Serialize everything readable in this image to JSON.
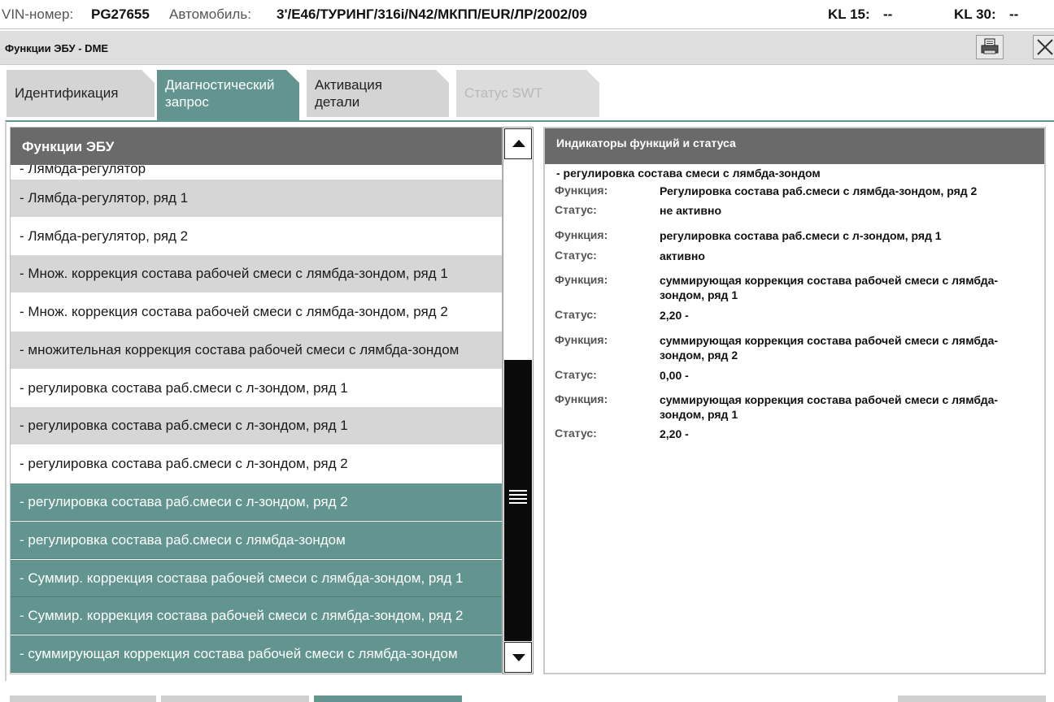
{
  "infobar": {
    "vin_label": "VIN-номер:",
    "vin_value": "PG27655",
    "car_label": "Автомобиль:",
    "car_value": "3'/E46/ТУРИНГ/316i/N42/МКПП/EUR/ЛР/2002/09",
    "kl15_label": "KL 15:",
    "kl15_value": "--",
    "kl30_label": "KL 30:",
    "kl30_value": "--"
  },
  "window": {
    "title": "Функции ЭБУ - DME",
    "print_icon": "printer-icon",
    "close_icon": "close-icon"
  },
  "tabs": [
    {
      "label_line1": "Идентификация",
      "label_line2": "",
      "state": "normal"
    },
    {
      "label_line1": "Диагностический",
      "label_line2": "запрос",
      "state": "active"
    },
    {
      "label_line1": "Активация",
      "label_line2": "детали",
      "state": "normal"
    },
    {
      "label_line1": "Статус SWT",
      "label_line2": "",
      "state": "disabled"
    }
  ],
  "functions_list": {
    "header": "Функции ЭБУ",
    "partial_top": "- Лямбда-регулятор",
    "items": [
      {
        "label": "- Лямбда-регулятор, ряд 1",
        "style": "grey"
      },
      {
        "label": "- Лямбда-регулятор, ряд 2",
        "style": "white"
      },
      {
        "label": "- Множ. коррекция состава рабочей смеси с лямбда-зондом, ряд 1",
        "style": "grey"
      },
      {
        "label": "- Множ. коррекция состава рабочей смеси с лямбда-зондом, ряд 2",
        "style": "white"
      },
      {
        "label": "- множительная коррекция состава рабочей смеси с лямбда-зондом",
        "style": "grey"
      },
      {
        "label": "- регулировка состава раб.смеси с л-зондом, ряд 1",
        "style": "white"
      },
      {
        "label": "- регулировка состава раб.смеси с л-зондом, ряд 1",
        "style": "grey"
      },
      {
        "label": "- регулировка состава раб.смеси с л-зондом, ряд 2",
        "style": "white"
      },
      {
        "label": "- регулировка состава раб.смеси с л-зондом, ряд 2",
        "style": "selected"
      },
      {
        "label": "- регулировка состава раб.смеси с лямбда-зондом",
        "style": "selected"
      },
      {
        "label": "- Суммир. коррекция состава рабочей смеси с лямбда-зондом, ряд 1",
        "style": "selected"
      },
      {
        "label": "- Суммир. коррекция состава рабочей смеси с лямбда-зондом, ряд 2",
        "style": "selected"
      },
      {
        "label": "- суммирующая коррекция состава рабочей смеси с лямбда-зондом",
        "style": "selected"
      }
    ]
  },
  "scrollbar": {
    "up_icon": "arrow-up-icon",
    "down_icon": "arrow-down-icon",
    "grip_icon": "grip-lines-icon"
  },
  "indicators": {
    "header": "Индикаторы функций и статуса",
    "group_title": "- регулировка состава смеси с лямбда-зондом",
    "function_label": "Функция:",
    "status_label": "Статус:",
    "entries": [
      {
        "function": "Регулировка состава раб.смеси с лямбда-зондом, ряд 2",
        "status": "не активно"
      },
      {
        "function": "регулировка состава раб.смеси с л-зондом, ряд 1",
        "status": "активно"
      },
      {
        "function": "суммирующая коррекция состава рабочей смеси с лямбда-зондом, ряд 1",
        "status": "2,20  -"
      },
      {
        "function": "суммирующая коррекция состава рабочей смеси с лямбда-зондом, ряд 2",
        "status": "0,00  -"
      },
      {
        "function": "суммирующая коррекция состава рабочей смеси с лямбда-зондом, ряд 1",
        "status": "2,20  -"
      }
    ]
  },
  "colors": {
    "accent": "#62958f",
    "header_grey": "#6a6a6a",
    "row_grey": "#d6d6d6"
  }
}
